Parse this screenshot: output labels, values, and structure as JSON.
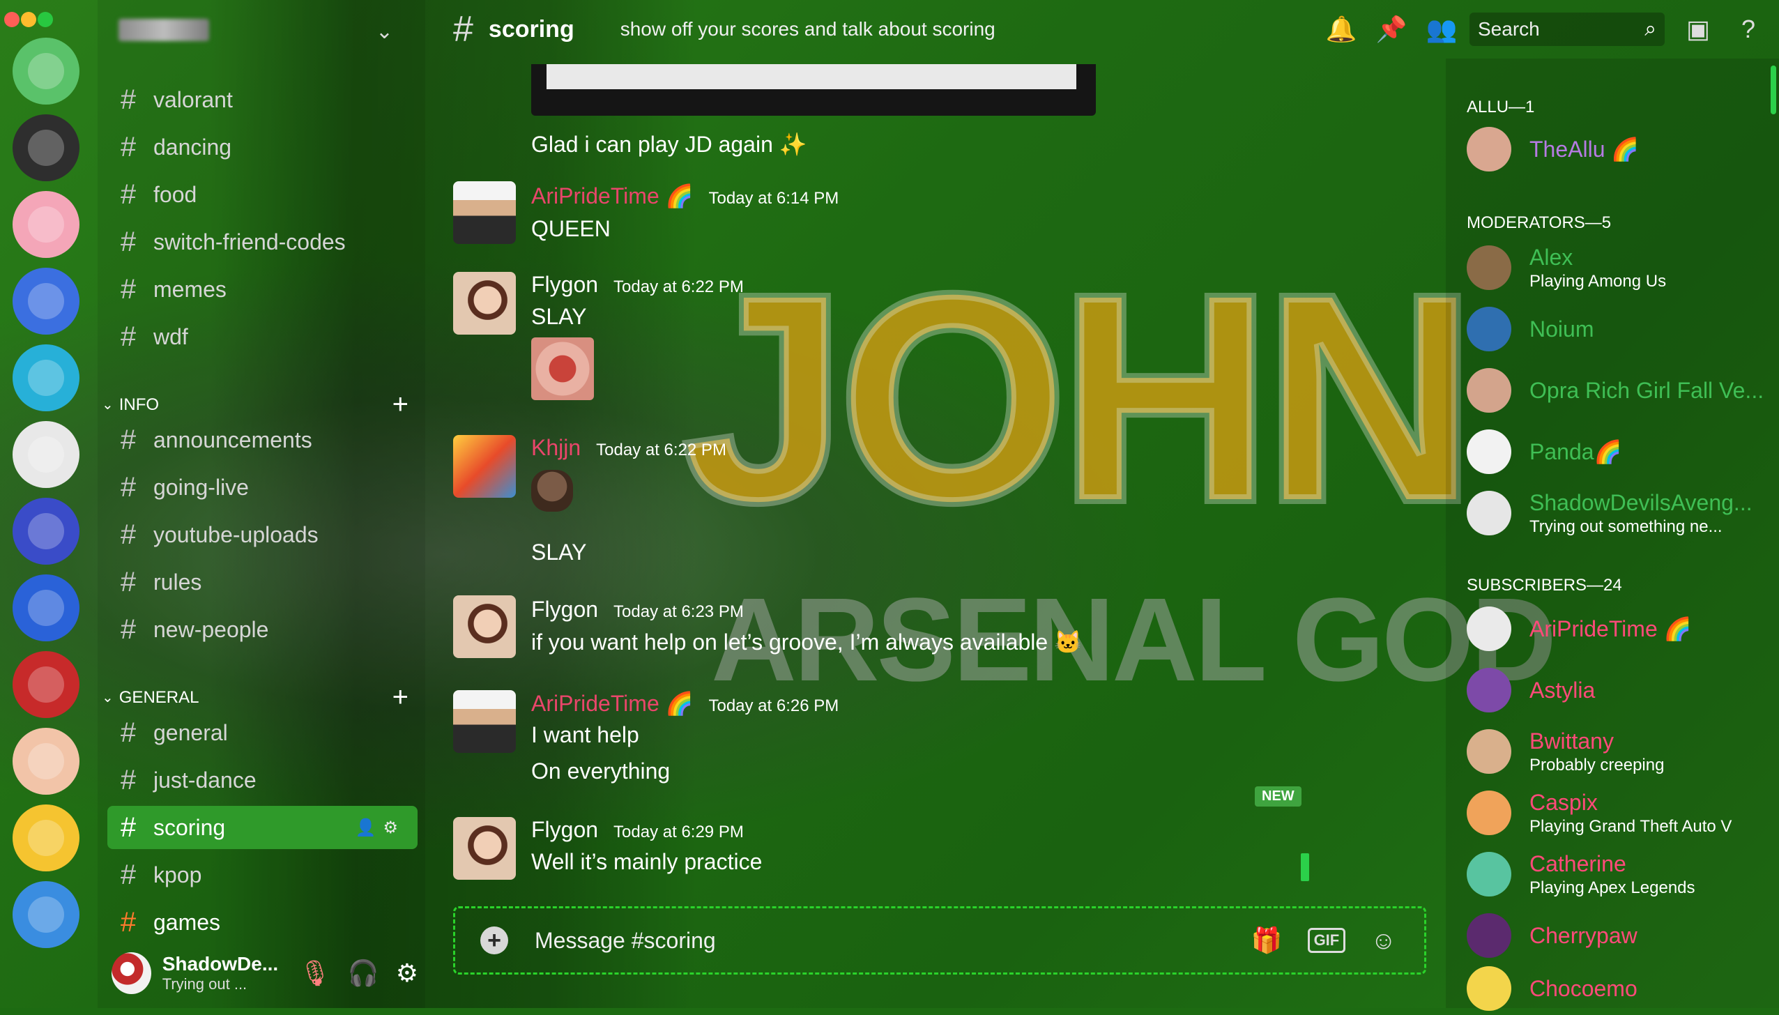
{
  "window": {
    "traffic_colors": [
      "#ff5f57",
      "#febc2e",
      "#28c840"
    ]
  },
  "server": {
    "name_hidden": ""
  },
  "channels": {
    "list_top": [
      "valorant",
      "dancing",
      "food",
      "switch-friend-codes",
      "memes",
      "wdf"
    ],
    "info_label": "INFO",
    "info": [
      "announcements",
      "going-live",
      "youtube-uploads",
      "rules",
      "new-people"
    ],
    "general_label": "GENERAL",
    "general": [
      "general",
      "just-dance",
      "scoring",
      "kpop",
      "games"
    ]
  },
  "user": {
    "name": "ShadowDe...",
    "status": "Trying out ..."
  },
  "header": {
    "channel": "scoring",
    "topic": "show off your scores and talk about scoring",
    "search_placeholder": "Search"
  },
  "messages": {
    "m0": {
      "text": "Glad i can play JD again ✨"
    },
    "m1": {
      "author": "AriPrideTime 🌈",
      "time": "Today at 6:14 PM",
      "text": "QUEEN"
    },
    "m2": {
      "author": "Flygon",
      "time": "Today at 6:22 PM",
      "text": "SLAY"
    },
    "m3": {
      "author": "Khjjn",
      "time": "Today at 6:22 PM",
      "text": "SLAY"
    },
    "m4": {
      "author": "Flygon",
      "time": "Today at 6:23 PM",
      "text": "if you want help on let’s groove, I’m always available 🐱"
    },
    "m5": {
      "author": "AriPrideTime 🌈",
      "time": "Today at 6:26 PM",
      "text": "I want help",
      "text2": "On everything"
    },
    "m6": {
      "author": "Flygon",
      "time": "Today at 6:29 PM",
      "text": "Well it’s mainly practice"
    },
    "new_badge": "NEW"
  },
  "composer": {
    "placeholder": "Message #scoring",
    "gif": "GIF"
  },
  "members": {
    "g1": "ALLU—1",
    "g2": "MODERATORS—5",
    "g3": "SUBSCRIBERS—24",
    "allu": [
      {
        "name": "TheAllu 🌈",
        "activity": ""
      }
    ],
    "mods": [
      {
        "name": "Alex",
        "activity": "Playing Among Us"
      },
      {
        "name": "Noium",
        "activity": ""
      },
      {
        "name": "Opra Rich Girl Fall Ve...",
        "activity": ""
      },
      {
        "name": "Panda🌈",
        "activity": ""
      },
      {
        "name": "ShadowDevilsAveng...",
        "activity": "Trying out something ne..."
      }
    ],
    "subs": [
      {
        "name": "AriPrideTime 🌈",
        "activity": ""
      },
      {
        "name": "Astylia",
        "activity": ""
      },
      {
        "name": "Bwittany",
        "activity": "Probably creeping"
      },
      {
        "name": "Caspix",
        "activity": "Playing Grand Theft Auto V"
      },
      {
        "name": "Catherine",
        "activity": "Playing Apex Legends"
      },
      {
        "name": "Cherrypaw",
        "activity": ""
      },
      {
        "name": "Chocoemo",
        "activity": ""
      }
    ]
  },
  "colors": {
    "ari": "#e9466b",
    "flygon": "#ffffff",
    "khjjn": "#e9466b",
    "theallu": "#b67be3",
    "mod": "#3fbf55",
    "sub": "#ff4a7a",
    "active_channel": "#2f9a2a"
  }
}
